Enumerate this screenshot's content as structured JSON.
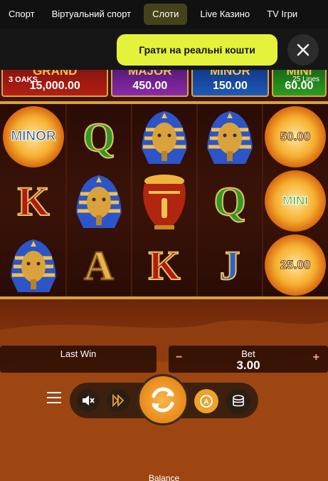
{
  "nav": {
    "tabs": [
      {
        "label": "Спорт"
      },
      {
        "label": "Віртуальний спорт"
      },
      {
        "label": "Слоти",
        "active": true
      },
      {
        "label": "Live Казино"
      },
      {
        "label": "TV Ігри"
      }
    ]
  },
  "cta": {
    "label": "Грати на реальні кошти",
    "close_icon": "close-icon",
    "color": "#e5f23b"
  },
  "game": {
    "ways_label": "3 OAKS",
    "lines_label": "25 Lines",
    "jackpots": [
      {
        "name": "GRAND",
        "value": "15,000.00"
      },
      {
        "name": "MAJOR",
        "value": "450.00"
      },
      {
        "name": "MINOR",
        "value": "150.00"
      },
      {
        "name": "MINI",
        "value": "60.00"
      }
    ],
    "grid": {
      "row1": [
        "MINOR",
        "Q",
        "pharaoh",
        "pharaoh",
        "50.00"
      ],
      "row2": [
        "K",
        "pharaoh",
        "urn",
        "Q",
        "MINI"
      ],
      "row3": [
        "pharaoh",
        "A",
        "K",
        "J",
        "25.00"
      ]
    },
    "last_win_label": "Last Win",
    "last_win_value": "",
    "bet_label": "Bet",
    "bet_value": "3.00",
    "bet_minus": "−",
    "bet_plus": "+",
    "balance_label": "Balance",
    "icons": [
      "menu-icon",
      "sound-off-icon",
      "turbo-icon",
      "spin-icon",
      "autoplay-icon",
      "coins-icon"
    ]
  }
}
